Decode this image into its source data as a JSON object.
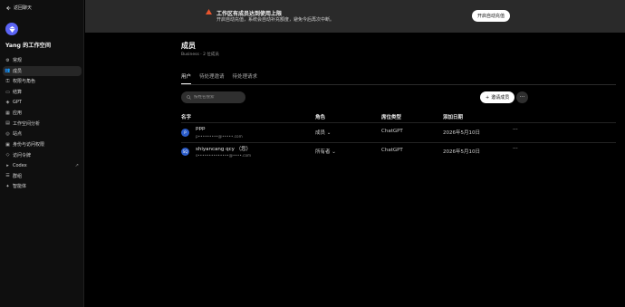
{
  "sidebar": {
    "back_label": "返回聊天",
    "workspace_name": "Yang 的工作空间",
    "items": [
      {
        "label": "常规",
        "icon": "gear-icon",
        "external": false
      },
      {
        "label": "成员",
        "icon": "users-icon",
        "external": false,
        "active": true
      },
      {
        "label": "权限与角色",
        "icon": "key-icon",
        "external": false
      },
      {
        "label": "结算",
        "icon": "card-icon",
        "external": false
      },
      {
        "label": "GPT",
        "icon": "cube-icon",
        "external": false
      },
      {
        "label": "应用",
        "icon": "grid-icon",
        "external": false
      },
      {
        "label": "工作空间分析",
        "icon": "chart-icon",
        "external": false
      },
      {
        "label": "站点",
        "icon": "globe-icon",
        "external": false
      },
      {
        "label": "身份与访问权限",
        "icon": "id-icon",
        "external": false
      },
      {
        "label": "访问令牌",
        "icon": "token-icon",
        "external": false
      },
      {
        "label": "Codex",
        "icon": "terminal-icon",
        "external": true
      },
      {
        "label": "群组",
        "icon": "group-icon",
        "external": false
      },
      {
        "label": "智能体",
        "icon": "agent-icon",
        "external": false
      }
    ],
    "external_glyph": "↗"
  },
  "banner": {
    "title": "工作区有成员达到使用上限",
    "subtitle": "开启自动充值，系统会自动补充额度，避免今后再次中断。",
    "button_label": "开启自动充值",
    "warn_color": "#e8552e"
  },
  "page": {
    "title": "成员",
    "subtitle": "Business · 2 位成员",
    "tabs": [
      "用户",
      "待处理邀请",
      "待处理请求"
    ],
    "search_placeholder": "按姓名搜索",
    "invite_label": "邀请成员",
    "more_label": "···"
  },
  "table": {
    "headers": {
      "name": "名字",
      "role": "角色",
      "seat": "席位类型",
      "date": "添加日期"
    },
    "rows": [
      {
        "avatar": "P",
        "name": "ppp",
        "email": "p•••••••••@•••••.com",
        "role": "成员",
        "seat": "ChatGPT",
        "date": "2026年5月10日",
        "more": "···"
      },
      {
        "avatar": "SQ",
        "name": "shiyancang qcy （您）",
        "email": "s••••••••••••••@••••.com",
        "role": "所有者",
        "seat": "ChatGPT",
        "date": "2026年5月10日",
        "more": "···"
      }
    ]
  }
}
